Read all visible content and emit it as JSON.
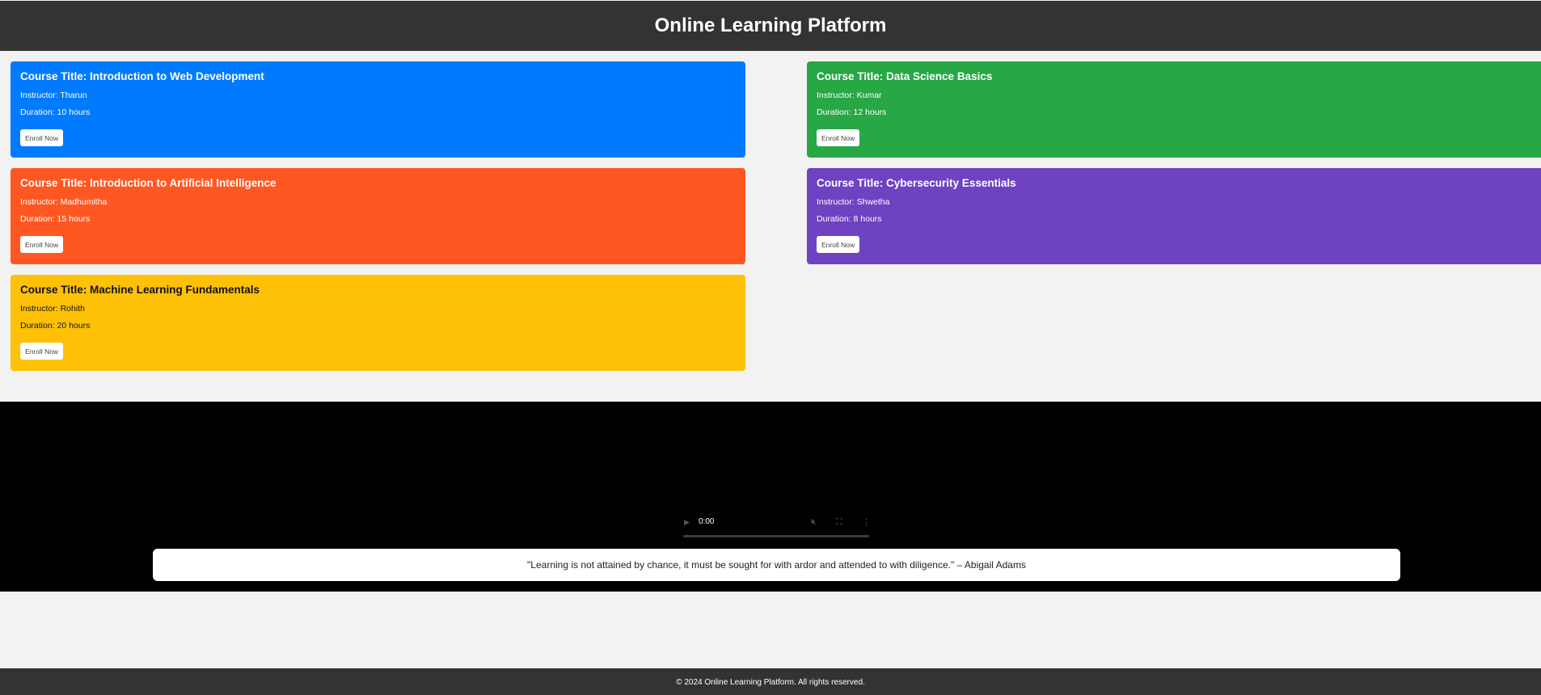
{
  "header": {
    "title": "Online Learning Platform"
  },
  "courses": [
    {
      "title": "Course Title: Introduction to Web Development",
      "instructor": "Instructor: Tharun",
      "duration": "Duration: 10 hours",
      "button": "Enroll Now",
      "color": "#007bff"
    },
    {
      "title": "Course Title: Data Science Basics",
      "instructor": "Instructor: Kumar",
      "duration": "Duration: 12 hours",
      "button": "Enroll Now",
      "color": "#28a745"
    },
    {
      "title": "Course Title: Introduction to Artificial Intelligence",
      "instructor": "Instructor: Madhumitha",
      "duration": "Duration: 15 hours",
      "button": "Enroll Now",
      "color": "#ff5722"
    },
    {
      "title": "Course Title: Cybersecurity Essentials",
      "instructor": "Instructor: Shwetha",
      "duration": "Duration: 8 hours",
      "button": "Enroll Now",
      "color": "#6f42c1"
    },
    {
      "title": "Course Title: Machine Learning Fundamentals",
      "instructor": "Instructor: Rohith",
      "duration": "Duration: 20 hours",
      "button": "Enroll Now",
      "color": "#ffc107"
    }
  ],
  "video": {
    "time": "0:00",
    "icons": [
      "play-icon",
      "volume-icon",
      "fullscreen-icon",
      "more-options-icon"
    ]
  },
  "quote": {
    "text": "\"Learning is not attained by chance, it must be sought for with ardor and attended to with diligence.\" – Abigail Adams"
  },
  "footer": {
    "text": "© 2024 Online Learning Platform. All rights reserved."
  }
}
